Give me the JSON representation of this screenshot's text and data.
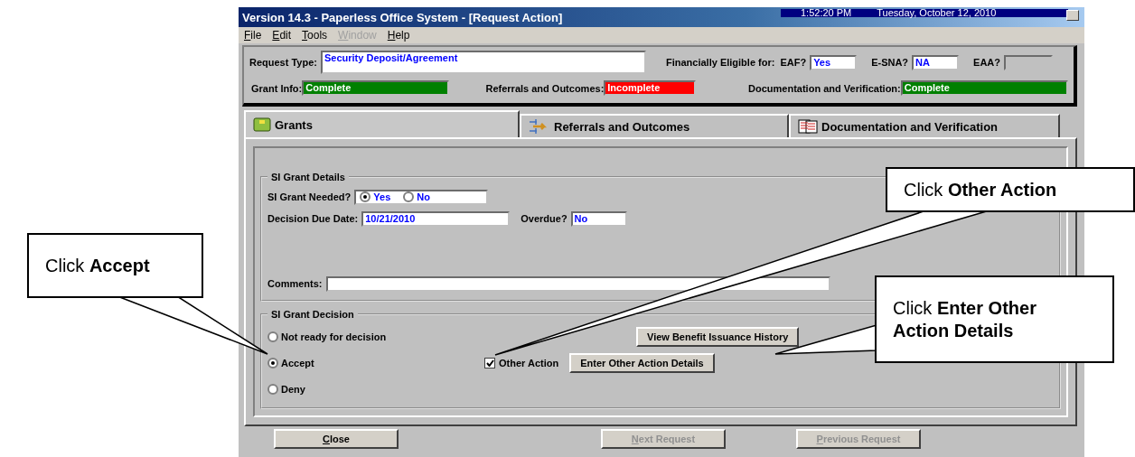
{
  "window": {
    "title": "Version 14.3 - Paperless Office System - [Request Action]",
    "time": "1:52:20 PM",
    "date": "Tuesday, October 12, 2010"
  },
  "menu": [
    {
      "label": "File",
      "disabled": false
    },
    {
      "label": "Edit",
      "disabled": false
    },
    {
      "label": "Tools",
      "disabled": false
    },
    {
      "label": "Window",
      "disabled": true
    },
    {
      "label": "Help",
      "disabled": false
    }
  ],
  "header": {
    "request_type": {
      "label": "Request Type:",
      "value": "Security Deposit/Agreement"
    },
    "eligible_label": "Financially Eligible for:",
    "eligibility": [
      {
        "label": "EAF?",
        "value": "Yes",
        "disabled": false
      },
      {
        "label": "E-SNA?",
        "value": "NA",
        "disabled": false
      },
      {
        "label": "EAA?",
        "disabled": true
      }
    ],
    "statuses": [
      {
        "label": "Grant Info:",
        "value": "Complete",
        "color": "#008000"
      },
      {
        "label": "Referrals and Outcomes:",
        "value": "Incomplete",
        "color": "#ff0000"
      },
      {
        "label": "Documentation and Verification:",
        "value": "Complete",
        "color": "#008000"
      }
    ]
  },
  "tabs": [
    {
      "label": "Grants",
      "selected": true,
      "kind": "grants"
    },
    {
      "label": "Referrals and Outcomes",
      "selected": false,
      "kind": "referrals"
    },
    {
      "label": "Documentation and Verification",
      "selected": false,
      "kind": "documents"
    }
  ],
  "details": {
    "title": "SI Grant Details",
    "needed": {
      "label": "SI Grant Needed?",
      "options": [
        {
          "label": "Yes",
          "selected": true
        },
        {
          "label": "No",
          "selected": false
        }
      ]
    },
    "due_date": {
      "label": "Decision Due Date:",
      "value": "10/21/2010"
    },
    "overdue": {
      "label": "Overdue?",
      "value": "No"
    },
    "comments": {
      "label": "Comments:"
    }
  },
  "decision": {
    "title": "SI Grant Decision",
    "options": [
      {
        "label": "Not ready for decision",
        "selected": false
      },
      {
        "label": "Accept",
        "selected": true
      },
      {
        "label": "Deny",
        "selected": false
      }
    ],
    "other_action": {
      "label": "Other Action",
      "checked": true
    },
    "buttons": [
      {
        "label": "View Benefit Issuance History"
      },
      {
        "label": "Enter Other Action Details"
      }
    ]
  },
  "footer_buttons": [
    {
      "label": "Close",
      "disabled": false
    },
    {
      "label": "Next Request",
      "disabled": true
    },
    {
      "label": "Previous Request",
      "disabled": true
    }
  ],
  "callouts": [
    {
      "text": "Click **Accept**"
    },
    {
      "text": "Click **Other Action**"
    },
    {
      "text": "Click **Enter Other Action Details**"
    }
  ]
}
